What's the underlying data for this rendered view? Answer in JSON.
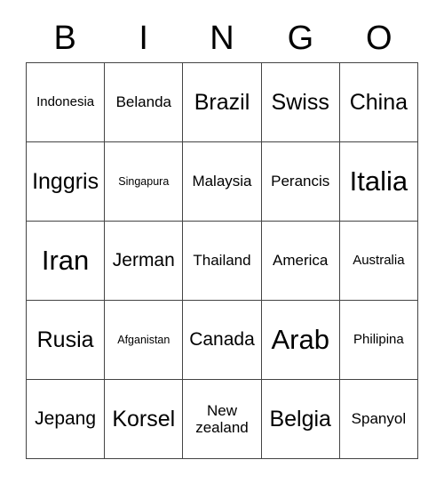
{
  "header": {
    "letters": [
      "B",
      "I",
      "N",
      "G",
      "O"
    ]
  },
  "grid": {
    "rows": 5,
    "columns": 5,
    "cells": [
      [
        {
          "label": "Indonesia",
          "size": "s-sm"
        },
        {
          "label": "Belanda",
          "size": "s-md"
        },
        {
          "label": "Brazil",
          "size": "s-xl"
        },
        {
          "label": "Swiss",
          "size": "s-xl"
        },
        {
          "label": "China",
          "size": "s-xl"
        }
      ],
      [
        {
          "label": "Inggris",
          "size": "s-xl"
        },
        {
          "label": "Singapura",
          "size": "s-xs"
        },
        {
          "label": "Malaysia",
          "size": "s-md"
        },
        {
          "label": "Perancis",
          "size": "s-md"
        },
        {
          "label": "Italia",
          "size": "s-xxl"
        }
      ],
      [
        {
          "label": "Iran",
          "size": "s-xxl"
        },
        {
          "label": "Jerman",
          "size": "s-lg"
        },
        {
          "label": "Thailand",
          "size": "s-md"
        },
        {
          "label": "America",
          "size": "s-md"
        },
        {
          "label": "Australia",
          "size": "s-sm"
        }
      ],
      [
        {
          "label": "Rusia",
          "size": "s-xl"
        },
        {
          "label": "Afganistan",
          "size": "s-xs"
        },
        {
          "label": "Canada",
          "size": "s-lg"
        },
        {
          "label": "Arab",
          "size": "s-xxl"
        },
        {
          "label": "Philipina",
          "size": "s-sm"
        }
      ],
      [
        {
          "label": "Jepang",
          "size": "s-lg"
        },
        {
          "label": "Korsel",
          "size": "s-xl"
        },
        {
          "label": "New zealand",
          "size": "s-md"
        },
        {
          "label": "Belgia",
          "size": "s-xl"
        },
        {
          "label": "Spanyol",
          "size": "s-md"
        }
      ]
    ]
  },
  "colors": {
    "border": "#444444",
    "text": "#000000",
    "background": "#ffffff"
  }
}
